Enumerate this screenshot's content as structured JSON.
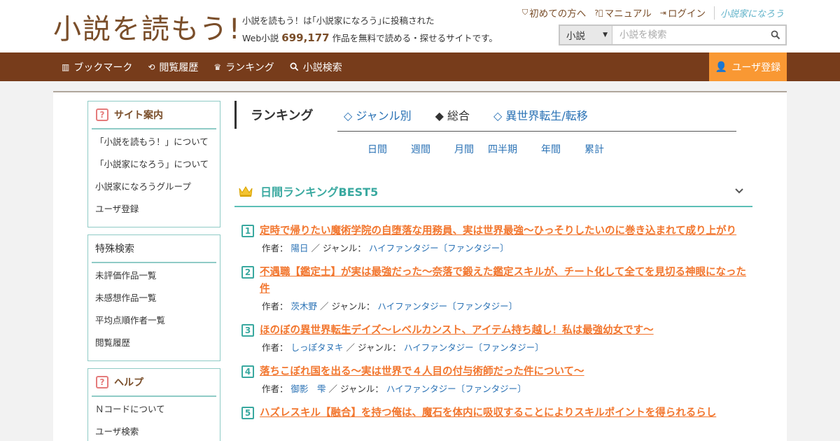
{
  "header": {
    "logo_text": "小説を読もう!",
    "tagline_line1": "小説を読もう！は｢小説家になろう｣に投稿された",
    "tagline_prefix": "Web小説",
    "tagline_count": "699,177",
    "tagline_suffix": "作品を無料で読める・探せるサイトです。",
    "top_links": [
      {
        "label": "初めての方へ",
        "icon": "shield-icon"
      },
      {
        "label": "マニュアル",
        "icon": "question-circle-icon"
      },
      {
        "label": "ログイン",
        "icon": "login-icon"
      }
    ],
    "partner_logo": "小説家になろう",
    "search": {
      "scope": "小説",
      "placeholder": "小説を検索"
    }
  },
  "nav": {
    "items": [
      {
        "label": "ブックマーク",
        "icon": "bookshelf-icon"
      },
      {
        "label": "閲覧履歴",
        "icon": "history-icon"
      },
      {
        "label": "ランキング",
        "icon": "crown-icon"
      },
      {
        "label": "小説検索",
        "icon": "search-icon"
      }
    ],
    "register_label": "ユーザ登録"
  },
  "sidebar": {
    "site_guide": {
      "title": "サイト案内",
      "items": [
        "「小説を読もう！」について",
        "「小説家になろう」について",
        "小説家になろうグループ",
        "ユーザ登録"
      ]
    },
    "special_search": {
      "title": "特殊検索",
      "items": [
        "未評価作品一覧",
        "未感想作品一覧",
        "平均点順作者一覧",
        "閲覧履歴"
      ]
    },
    "help": {
      "title": "ヘルプ",
      "items": [
        "Ｎコードについて",
        "ユーザ検索"
      ]
    }
  },
  "main": {
    "heading": "ランキング",
    "tabs": [
      {
        "label": "◇ ジャンル別",
        "active": false
      },
      {
        "label": "◆ 総合",
        "active": true
      },
      {
        "label": "◇ 異世界転生/転移",
        "active": false
      }
    ],
    "periods": [
      "日間",
      "週間",
      "月間",
      "四半期",
      "年間",
      "累計"
    ],
    "section_title": "日間ランキングBEST5",
    "author_label": "作者：",
    "genre_label": "／ ジャンル：",
    "rankings": [
      {
        "rank": "1",
        "title": "定時で帰りたい魔術学院の自堕落な用務員、実は世界最強～ひっそりしたいのに巻き込まれて成り上がり",
        "author": "陽日",
        "genre": "ハイファンタジー〔ファンタジー〕"
      },
      {
        "rank": "2",
        "title": "不遇職【鑑定士】が実は最強だった〜奈落で鍛えた鑑定スキルが、チート化して全てを見切る神眼になった件",
        "author": "茨木野",
        "genre": "ハイファンタジー〔ファンタジー〕"
      },
      {
        "rank": "3",
        "title": "ほのぼの異世界転生デイズ～レベルカンスト、アイテム持ち越し！私は最強幼女です～",
        "author": "しっぽタヌキ",
        "genre": "ハイファンタジー〔ファンタジー〕"
      },
      {
        "rank": "4",
        "title": "落ちこぼれ国を出る〜実は世界で４人目の付与術師だった件について〜",
        "author": "御影　雫",
        "genre": "ハイファンタジー〔ファンタジー〕"
      },
      {
        "rank": "5",
        "title": "ハズレスキル【融合】を持つ俺は、魔石を体内に吸収することによりスキルポイントを得られるらし",
        "author": "",
        "genre": ""
      }
    ]
  },
  "colors": {
    "brand_brown": "#773c1b",
    "accent_orange": "#f99833",
    "teal": "#3aa9a0",
    "title_orange": "#f2762e",
    "link_blue": "#2a72b5"
  }
}
